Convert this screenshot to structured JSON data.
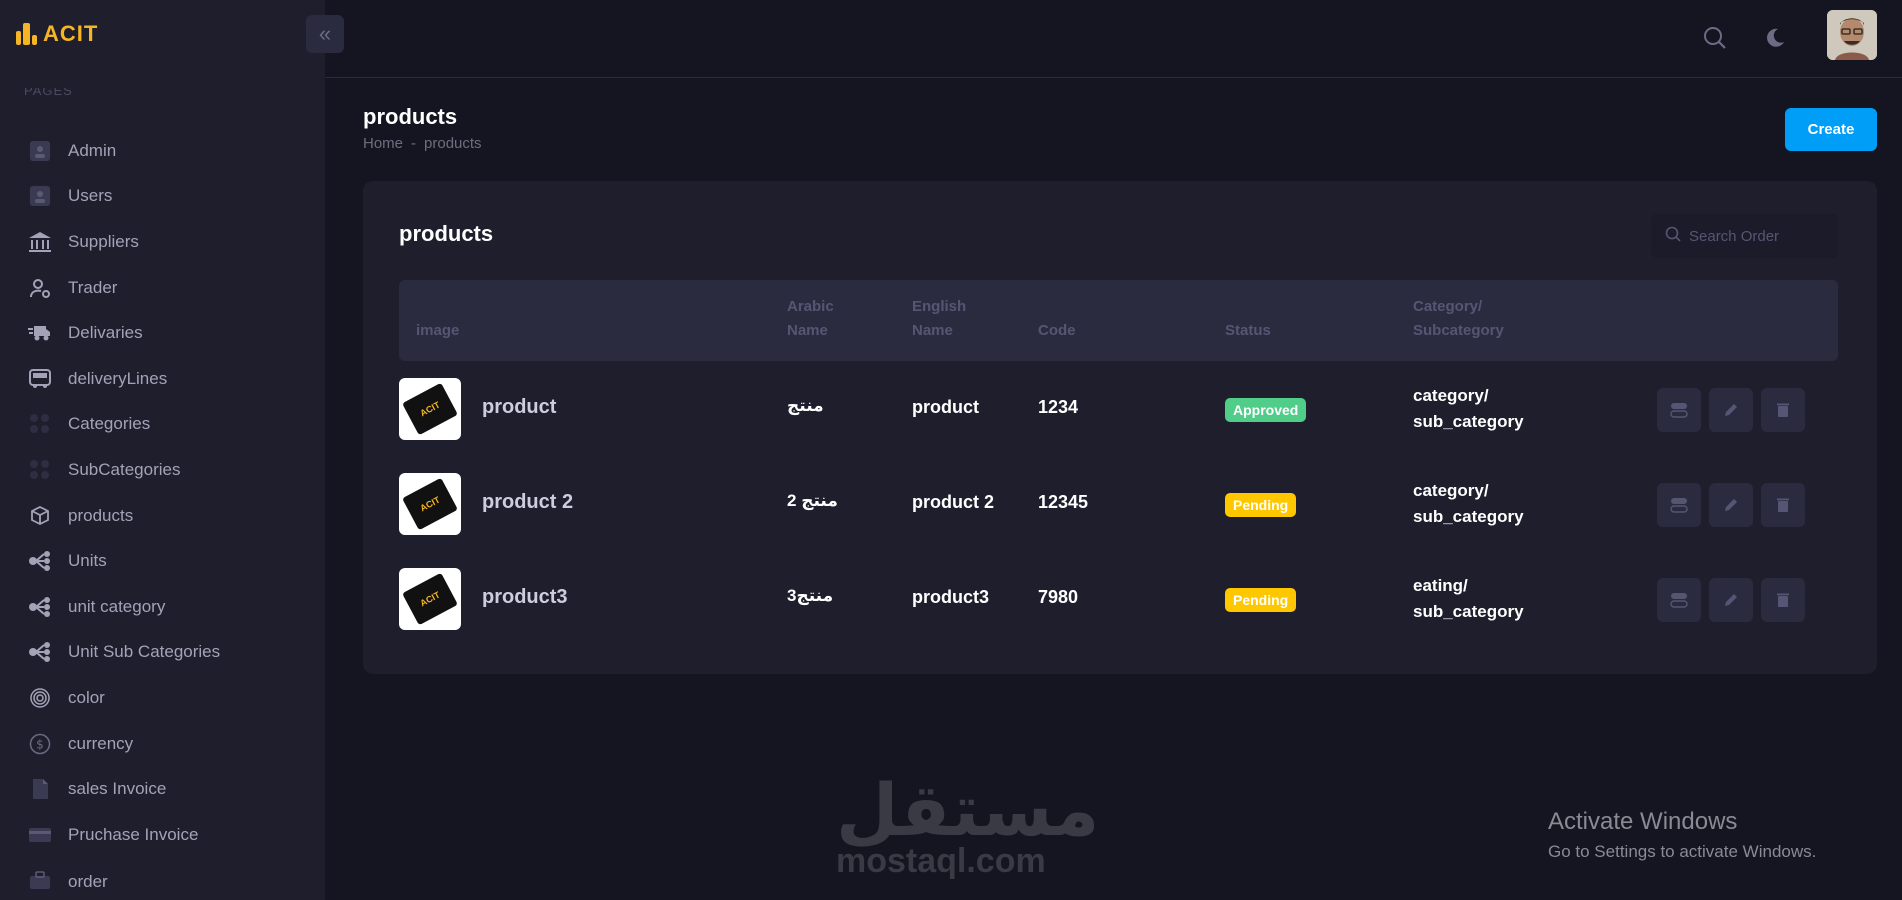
{
  "app": {
    "logo_text": "ACIT"
  },
  "sidebar": {
    "section_label": "PAGES",
    "items": [
      {
        "label": "Admin",
        "icon": "user-card-icon"
      },
      {
        "label": "Users",
        "icon": "user-card-icon"
      },
      {
        "label": "Suppliers",
        "icon": "bank-icon"
      },
      {
        "label": "Trader",
        "icon": "user-gear-icon"
      },
      {
        "label": "Delivaries",
        "icon": "truck-icon"
      },
      {
        "label": "deliveryLines",
        "icon": "bus-icon"
      },
      {
        "label": "Categories",
        "icon": "dots-grid-icon"
      },
      {
        "label": "SubCategories",
        "icon": "dots-grid-icon"
      },
      {
        "label": "products",
        "icon": "boxes-icon"
      },
      {
        "label": "Units",
        "icon": "hierarchy-icon"
      },
      {
        "label": "unit category",
        "icon": "hierarchy-icon"
      },
      {
        "label": "Unit Sub Categories",
        "icon": "hierarchy-icon"
      },
      {
        "label": "color",
        "icon": "fingerprint-icon"
      },
      {
        "label": "currency",
        "icon": "dollar-circle-icon"
      },
      {
        "label": "sales Invoice",
        "icon": "file-icon"
      },
      {
        "label": "Pruchase Invoice",
        "icon": "credit-card-icon"
      },
      {
        "label": "order",
        "icon": "briefcase-icon"
      }
    ]
  },
  "header": {
    "search_icon": "search-icon",
    "theme_icon": "moon-icon"
  },
  "page": {
    "title": "products",
    "breadcrumb": [
      "Home",
      "-",
      "products"
    ],
    "create_label": "Create"
  },
  "card": {
    "title": "products",
    "search_placeholder": "Search Order",
    "columns": {
      "image": "image",
      "arabic_1": "Arabic",
      "arabic_2": "Name",
      "english_1": "English",
      "english_2": "Name",
      "code": "Code",
      "status": "Status",
      "category_1": "Category/",
      "category_2": "Subcategory"
    },
    "rows": [
      {
        "name": "product",
        "arabic": "منتج",
        "english": "product",
        "code": "1234",
        "status": "Approved",
        "cat_1": "category/",
        "cat_2": "sub_category"
      },
      {
        "name": "product 2",
        "arabic": "منتج 2",
        "english": "product 2",
        "code": "12345",
        "status": "Pending",
        "cat_1": "category/",
        "cat_2": "sub_category"
      },
      {
        "name": "product3",
        "arabic": "منتج3",
        "english": "product3",
        "code": "7980",
        "status": "Pending",
        "cat_1": "eating/",
        "cat_2": "sub_category"
      }
    ],
    "image_logo_text": "ACIT"
  },
  "colors": {
    "accent": "#009ef7",
    "approved": "#50cd89",
    "pending": "#ffc700",
    "brand": "#f5b524"
  },
  "watermark": {
    "arabic": "مستقل",
    "english": "mostaql.com"
  },
  "os_notice": {
    "line1": "Activate Windows",
    "line2": "Go to Settings to activate Windows."
  }
}
